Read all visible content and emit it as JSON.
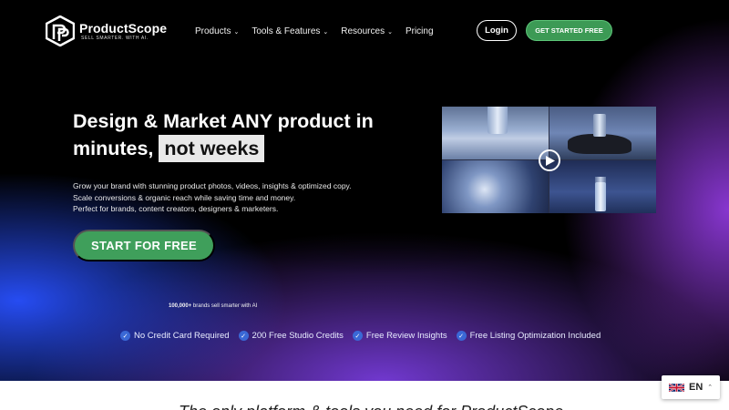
{
  "brand": {
    "name": "ProductScope",
    "tagline": "SELL SMARTER. WITH AI."
  },
  "nav": {
    "items": [
      {
        "label": "Products",
        "has_dropdown": true
      },
      {
        "label": "Tools & Features",
        "has_dropdown": true
      },
      {
        "label": "Resources",
        "has_dropdown": true
      },
      {
        "label": "Pricing",
        "has_dropdown": false
      }
    ],
    "login_label": "Login",
    "cta_label": "GET STARTED FREE"
  },
  "hero": {
    "headline_main": "Design & Market ANY product in minutes,",
    "headline_highlight": "not weeks",
    "description_lines": [
      "Grow your brand with stunning product photos, videos, insights & optimized copy.",
      "Scale conversions & organic reach while saving time and money.",
      "Perfect for brands, content creators, designers & marketers."
    ],
    "start_button": "START FOR FREE",
    "brands_count": "100,000+",
    "brands_text": "brands sell smarter with AI",
    "perks": [
      "No Credit Card Required",
      "200 Free Studio Credits",
      "Free Review Insights",
      "Free Listing Optimization Included"
    ]
  },
  "below": {
    "partial_text": "The only platform & tools you need for ProductScope"
  },
  "language": {
    "code": "EN"
  },
  "colors": {
    "accent_green": "#3f9f5b",
    "check_blue": "#3a68d6",
    "highlight_bg": "#e9e9e9"
  },
  "icons": {
    "logo": "productscope-logo-icon",
    "play": "play-icon",
    "check": "check-circle-icon",
    "flag": "uk-flag-icon",
    "chevron": "chevron-down-icon"
  }
}
